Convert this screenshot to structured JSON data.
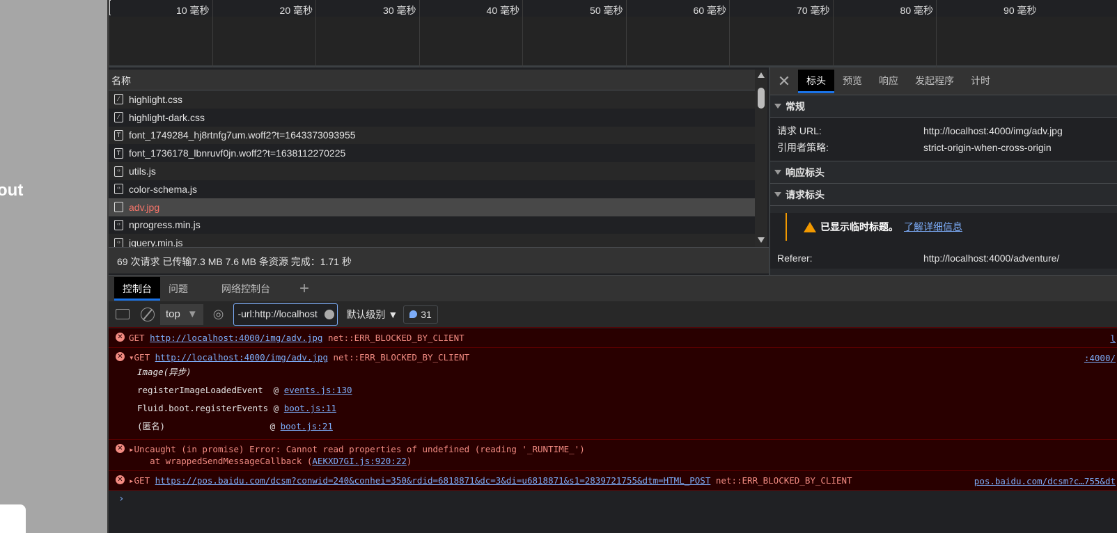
{
  "page": {
    "partial_text": "out"
  },
  "timeline": {
    "ticks": [
      "10 毫秒",
      "20 毫秒",
      "30 毫秒",
      "40 毫秒",
      "50 毫秒",
      "60 毫秒",
      "70 毫秒",
      "80 毫秒",
      "90 毫秒"
    ]
  },
  "network": {
    "header": "名称",
    "rows": [
      {
        "name": "highlight.css",
        "icon": "css-file-icon"
      },
      {
        "name": "highlight-dark.css",
        "icon": "css-file-icon"
      },
      {
        "name": "font_1749284_hj8rtnfg7um.woff2?t=1643373093955",
        "icon": "font-file-icon"
      },
      {
        "name": "font_1736178_lbnruvf0jn.woff2?t=1638112270225",
        "icon": "font-file-icon"
      },
      {
        "name": "utils.js",
        "icon": "script-file-icon"
      },
      {
        "name": "color-schema.js",
        "icon": "script-file-icon"
      },
      {
        "name": "adv.jpg",
        "icon": "image-file-icon",
        "selected": true,
        "error": true
      },
      {
        "name": "nprogress.min.js",
        "icon": "script-file-icon"
      },
      {
        "name": "jquery.min.js",
        "icon": "script-file-icon"
      }
    ],
    "status": "69 次请求  已传输7.3 MB  7.6 MB 条资源  完成：1.71 秒"
  },
  "detail": {
    "tabs": [
      "标头",
      "预览",
      "响应",
      "发起程序",
      "计时"
    ],
    "active_tab": "标头",
    "general_title": "常规",
    "general": [
      {
        "key": "请求 URL:",
        "value": "http://localhost:4000/img/adv.jpg"
      },
      {
        "key": "引用者策略:",
        "value": "strict-origin-when-cross-origin"
      }
    ],
    "response_headers_title": "响应标头",
    "request_headers_title": "请求标头",
    "warning": "已显示临时标题。",
    "warning_link": "了解详细信息",
    "request_headers": [
      {
        "key": "Referer:",
        "value": "http://localhost:4000/adventure/"
      }
    ]
  },
  "drawer": {
    "tabs": [
      "控制台",
      "问题",
      "网络控制台"
    ],
    "active_tab": "控制台"
  },
  "toolbar": {
    "context": "top",
    "filter": "-url:http://localhost",
    "level": "默认级别",
    "message_count": "31"
  },
  "console": {
    "m1": {
      "method": "GET",
      "url": "http://localhost:4000/img/adv.jpg",
      "error": "net::ERR_BLOCKED_BY_CLIENT",
      "source": "l"
    },
    "m2": {
      "method": "GET",
      "url": "http://localhost:4000/img/adv.jpg",
      "error": "net::ERR_BLOCKED_BY_CLIENT",
      "source": ":4000/",
      "stack_title": "Image(异步)",
      "frames": [
        {
          "fn": "registerImageLoadedEvent  @ ",
          "loc": "events.js:130"
        },
        {
          "fn": "Fluid.boot.registerEvents @ ",
          "loc": "boot.js:11"
        },
        {
          "fn": "(匿名)                    @ ",
          "loc": "boot.js:21"
        }
      ]
    },
    "m3": {
      "line1": "Uncaught (in promise) Error: Cannot read properties of undefined (reading '_RUNTIME_')",
      "line2_prefix": "    at wrappedSendMessageCallback (",
      "line2_link": "AEKXD7GI.js:920:22",
      "line2_suffix": ")"
    },
    "m4": {
      "method": "GET",
      "url": "https://pos.baidu.com/dcsm?conwid=240&conhei=350&rdid=6818871&dc=3&di=u6818871&s1=2839721755&dtm=HTML_POST",
      "error": "net::ERR_BLOCKED_BY_CLIENT",
      "source": "pos.baidu.com/dcsm?c…755&dt"
    },
    "prompt": "›"
  }
}
